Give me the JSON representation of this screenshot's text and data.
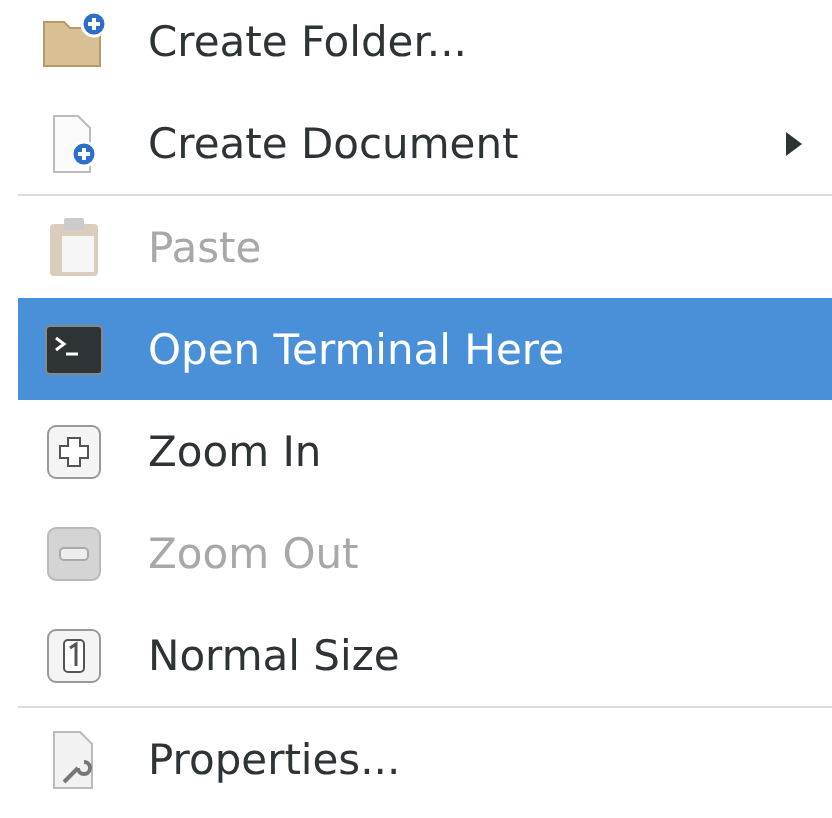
{
  "menu": {
    "items": [
      {
        "kind": "item",
        "label": "Create Folder...",
        "disabled": false,
        "selected": false,
        "submenu": false
      },
      {
        "kind": "item",
        "label": "Create Document",
        "disabled": false,
        "selected": false,
        "submenu": true
      },
      {
        "kind": "separator"
      },
      {
        "kind": "item",
        "label": "Paste",
        "disabled": true,
        "selected": false,
        "submenu": false
      },
      {
        "kind": "item",
        "label": "Open Terminal Here",
        "disabled": false,
        "selected": true,
        "submenu": false
      },
      {
        "kind": "item",
        "label": "Zoom In",
        "disabled": false,
        "selected": false,
        "submenu": false
      },
      {
        "kind": "item",
        "label": "Zoom Out",
        "disabled": true,
        "selected": false,
        "submenu": false
      },
      {
        "kind": "item",
        "label": "Normal Size",
        "disabled": false,
        "selected": false,
        "submenu": false
      },
      {
        "kind": "separator"
      },
      {
        "kind": "item",
        "label": "Properties...",
        "disabled": false,
        "selected": false,
        "submenu": false
      }
    ]
  }
}
